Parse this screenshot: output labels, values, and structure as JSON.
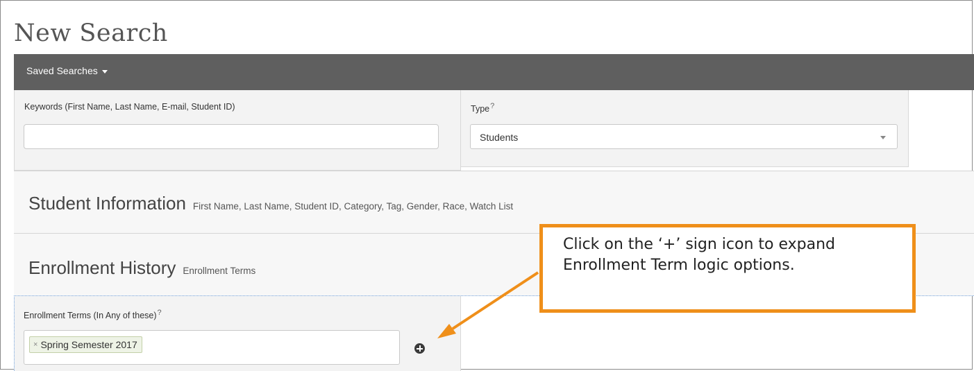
{
  "page": {
    "title": "New Search"
  },
  "toolbar": {
    "saved_searches_label": "Saved Searches"
  },
  "keywords": {
    "label": "Keywords (First Name, Last Name, E-mail, Student ID)",
    "value": "",
    "placeholder": ""
  },
  "type": {
    "label": "Type",
    "help": "?",
    "selected": "Students"
  },
  "sections": {
    "student_info": {
      "title": "Student Information",
      "subtitle": "First Name, Last Name, Student ID, Category, Tag, Gender, Race, Watch List"
    },
    "enrollment_history": {
      "title": "Enrollment History",
      "subtitle": "Enrollment Terms"
    }
  },
  "enrollment_terms": {
    "label": "Enrollment Terms (In Any of these)",
    "help": "?",
    "remove_glyph": "×",
    "tokens": [
      "Spring Semester 2017"
    ]
  },
  "callout": {
    "text": "Click on the ‘+’ sign icon to expand Enrollment Term logic options."
  },
  "colors": {
    "toolbar": "#5f5f5f",
    "callout_border": "#ef8f1a",
    "panel_bg": "#f3f3f3",
    "dotted_focus": "#6a9ad4"
  }
}
